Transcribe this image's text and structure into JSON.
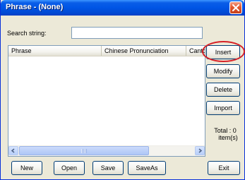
{
  "window": {
    "title": "Phrase - (None)"
  },
  "search": {
    "label": "Search string:",
    "value": ""
  },
  "list": {
    "columns": [
      "Phrase",
      "Chinese Pronunciation",
      "Canto"
    ]
  },
  "side_buttons": {
    "insert": "Insert",
    "modify": "Modify",
    "delete": "Delete",
    "import": "Import"
  },
  "total": {
    "line1": "Total :   0",
    "line2": "item(s)"
  },
  "bottom_buttons": {
    "new": "New",
    "open": "Open",
    "save": "Save",
    "saveas": "SaveAs",
    "exit": "Exit"
  },
  "icons": {
    "close": "close-icon",
    "scroll_left": "scroll-left-icon",
    "scroll_right": "scroll-right-icon"
  },
  "colors": {
    "titlebar": "#0055e5",
    "highlight_oval": "#d62027"
  }
}
